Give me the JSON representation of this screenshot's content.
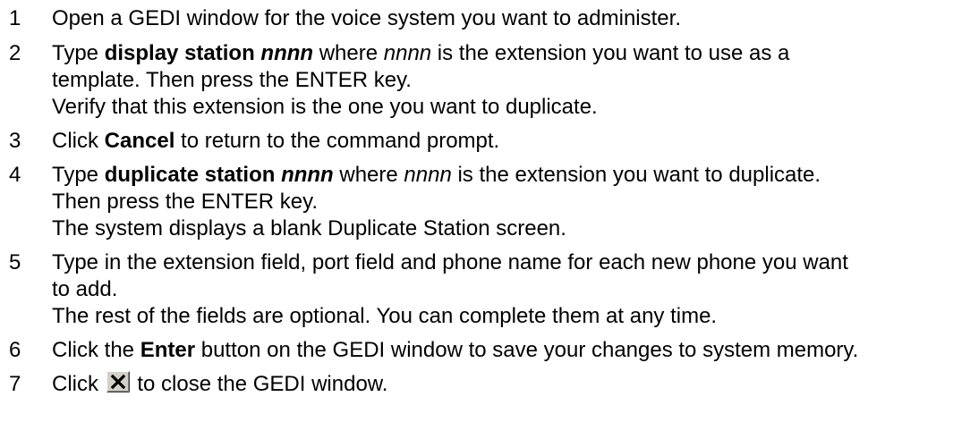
{
  "steps": [
    {
      "number": "1",
      "text": "Open a GEDI window for the voice system you want to administer."
    },
    {
      "number": "2",
      "type_word": "Type ",
      "cmd": "display station ",
      "var": "nnnn",
      "mid": " where ",
      "var2": "nnnn",
      "rest": " is the extension you want to use as a",
      "line2": "template. Then press the ENTER key.",
      "line3": "Verify that this extension is the one you want to duplicate."
    },
    {
      "number": "3",
      "click_word": "Click ",
      "cancel": "Cancel",
      "rest": " to return to the command prompt."
    },
    {
      "number": "4",
      "type_word": "Type ",
      "cmd": "duplicate station ",
      "var": "nnnn",
      "mid": " where ",
      "var2": "nnnn",
      "rest": " is the extension you want to duplicate.",
      "line2": "Then press the ENTER key.",
      "line3": "The system displays a blank Duplicate Station screen."
    },
    {
      "number": "5",
      "line1": "Type in the extension field, port field  and phone name for each new phone you want",
      "line2": "to add.",
      "line3": "The rest of the fields are optional. You can complete them at any time."
    },
    {
      "number": "6",
      "click_word": "Click the ",
      "enter": "Enter",
      "rest": " button on the GEDI window to save your changes to system memory."
    },
    {
      "number": "7",
      "click_word": "Click ",
      "rest": " to close the GEDI window.",
      "icon": "close-window-icon"
    }
  ]
}
